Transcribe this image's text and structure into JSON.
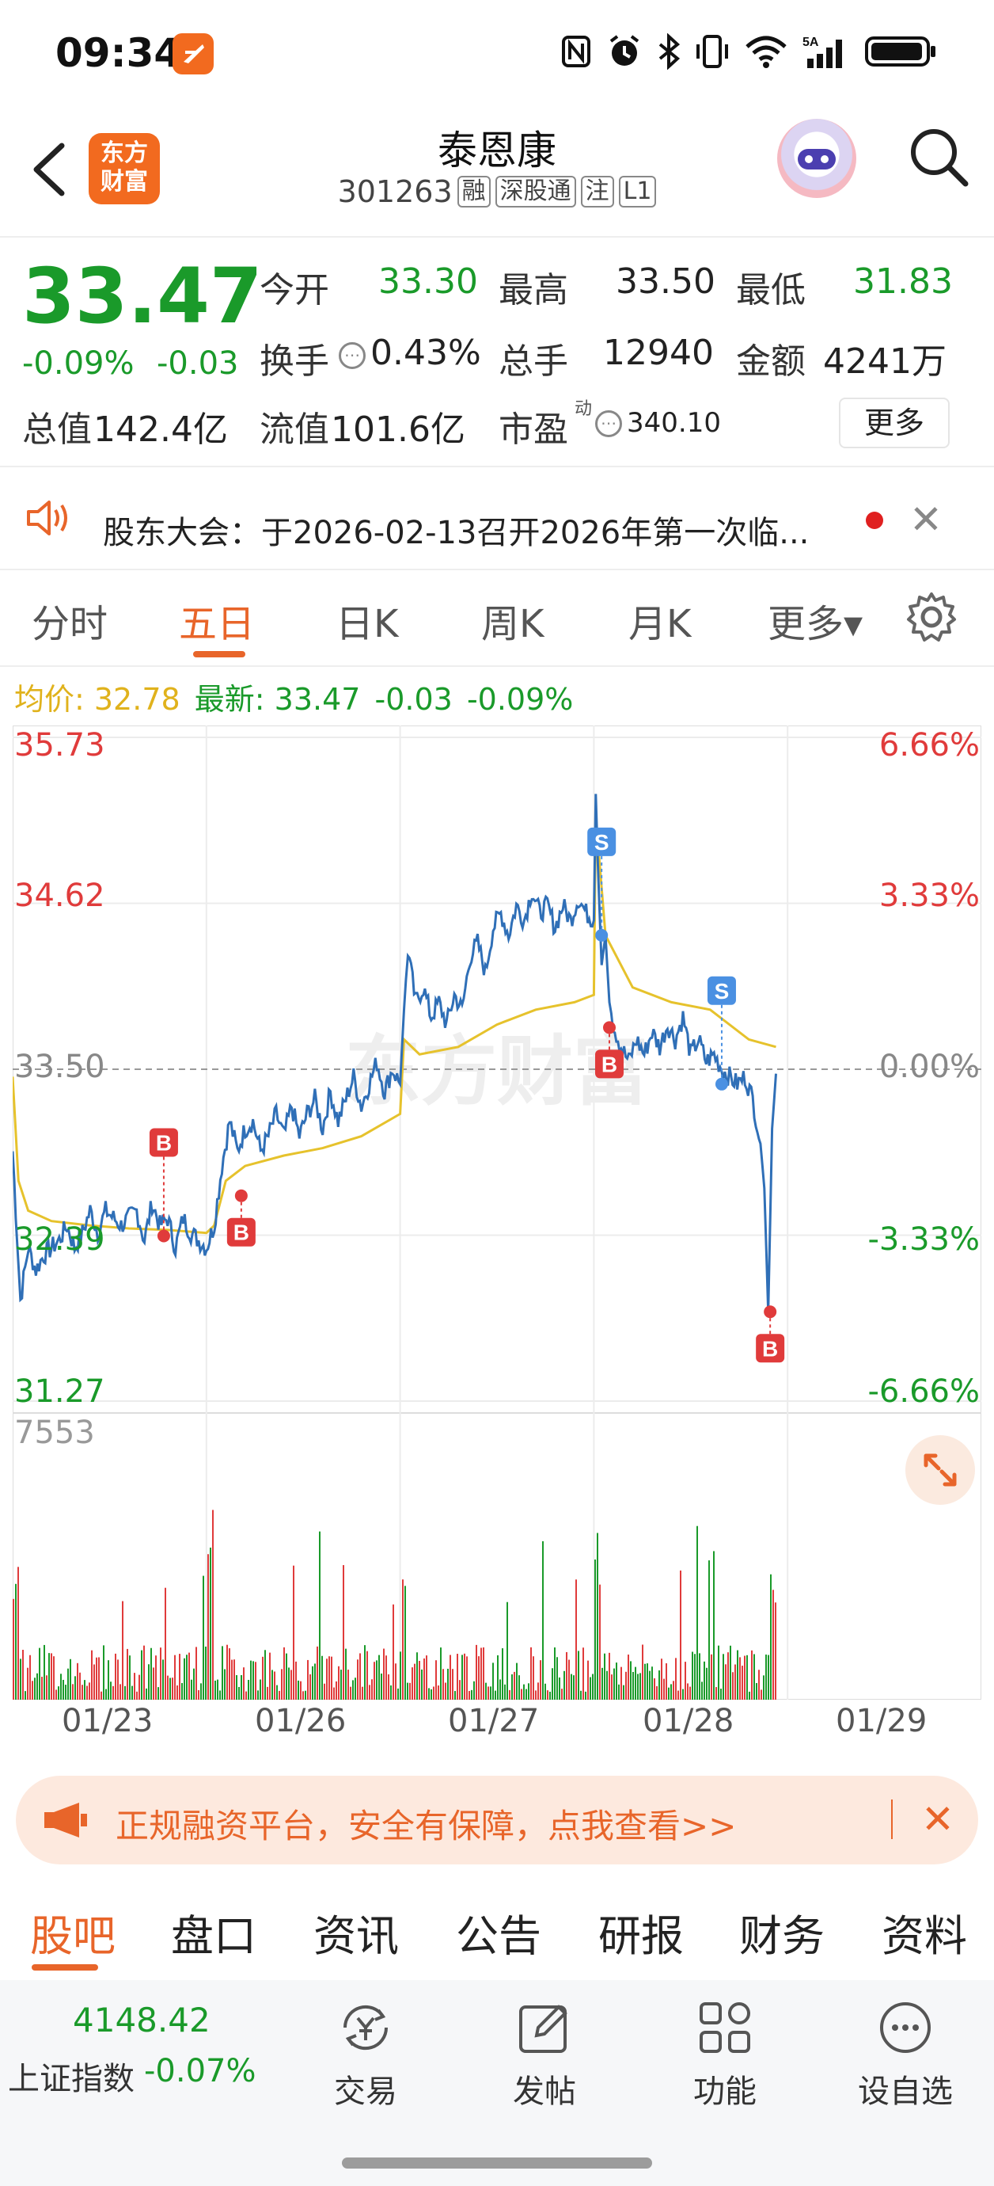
{
  "status_bar": {
    "time": "09:34",
    "icons": [
      "nfc-icon",
      "alarm-icon",
      "bluetooth-icon",
      "vibrate-icon",
      "wifi-icon",
      "signal-5a-icon",
      "battery-icon"
    ]
  },
  "header": {
    "logo_line1": "东方",
    "logo_line2": "财富",
    "stock_name": "泰恩康",
    "stock_code": "301263",
    "tags": [
      "融",
      "深股通",
      "注",
      "L1"
    ]
  },
  "quote": {
    "price": "33.47",
    "change_pct": "-0.09%",
    "change_abs": "-0.03",
    "open_label": "今开",
    "open": "33.30",
    "high_label": "最高",
    "high": "33.50",
    "low_label": "最低",
    "low": "31.83",
    "turnover_label": "换手",
    "turnover": "0.43%",
    "volume_label": "总手",
    "volume": "12940",
    "amount_label": "金额",
    "amount": "4241万",
    "mcap_label": "总值",
    "mcap": "142.4亿",
    "float_label": "流值",
    "float_mcap": "101.6亿",
    "pe_label": "市盈",
    "pe_sup": "动",
    "pe": "340.10",
    "more_label": "更多"
  },
  "notice": {
    "text": "股东大会：于2026-02-13召开2026年第一次临..."
  },
  "chart_tabs": [
    "分时",
    "五日",
    "日K",
    "周K",
    "月K",
    "更多▾"
  ],
  "active_chart_tab": "五日",
  "avg_line": {
    "avg": "均价: 32.78",
    "latest": "最新: 33.47",
    "chg": "-0.03",
    "pct": "-0.09%"
  },
  "watermark": "东方财富",
  "colors": {
    "accent": "#e8652a",
    "up": "#e03b3b",
    "down": "#1a9a2a",
    "price_line": "#2f6fb7",
    "avg_line": "#e6c22c"
  },
  "chart_data": {
    "type": "line",
    "title": "",
    "categories": [
      "01/23",
      "01/26",
      "01/27",
      "01/28",
      "01/29"
    ],
    "ylim": [
      31.27,
      35.73
    ],
    "y_ticks_left": [
      "35.73",
      "34.62",
      "33.50",
      "32.39",
      "31.27"
    ],
    "y_ticks_right": [
      "6.66%",
      "3.33%",
      "0.00%",
      "-3.33%",
      "-6.66%"
    ],
    "prev_close": 33.5,
    "volume_max_label": "7553",
    "series": [
      {
        "values": [
          [
            0.0,
            32.95
          ],
          [
            0.04,
            31.95
          ],
          [
            0.08,
            32.3
          ],
          [
            0.12,
            32.15
          ],
          [
            0.16,
            32.25
          ],
          [
            0.2,
            32.3
          ],
          [
            0.24,
            32.35
          ],
          [
            0.28,
            32.45
          ],
          [
            0.32,
            32.3
          ],
          [
            0.36,
            32.4
          ],
          [
            0.4,
            32.55
          ],
          [
            0.44,
            32.4
          ],
          [
            0.48,
            32.55
          ],
          [
            0.52,
            32.5
          ],
          [
            0.56,
            32.45
          ],
          [
            0.6,
            32.5
          ],
          [
            0.64,
            32.55
          ],
          [
            0.68,
            32.35
          ],
          [
            0.72,
            32.6
          ],
          [
            0.76,
            32.45
          ],
          [
            0.8,
            32.5
          ],
          [
            0.84,
            32.3
          ],
          [
            0.88,
            32.5
          ],
          [
            0.92,
            32.4
          ],
          [
            0.96,
            32.35
          ],
          [
            1.0,
            32.3
          ],
          [
            1.04,
            32.45
          ],
          [
            1.08,
            32.85
          ],
          [
            1.12,
            33.15
          ],
          [
            1.16,
            32.95
          ],
          [
            1.2,
            33.1
          ],
          [
            1.24,
            33.15
          ],
          [
            1.28,
            32.95
          ],
          [
            1.32,
            33.05
          ],
          [
            1.36,
            33.2
          ],
          [
            1.4,
            33.05
          ],
          [
            1.44,
            33.25
          ],
          [
            1.48,
            33.05
          ],
          [
            1.52,
            33.2
          ],
          [
            1.56,
            33.3
          ],
          [
            1.6,
            33.1
          ],
          [
            1.64,
            33.35
          ],
          [
            1.68,
            33.15
          ],
          [
            1.72,
            33.3
          ],
          [
            1.76,
            33.45
          ],
          [
            1.8,
            33.25
          ],
          [
            1.84,
            33.4
          ],
          [
            1.88,
            33.55
          ],
          [
            1.92,
            33.35
          ],
          [
            1.96,
            33.5
          ],
          [
            2.0,
            33.4
          ],
          [
            2.02,
            33.9
          ],
          [
            2.04,
            34.3
          ],
          [
            2.08,
            33.95
          ],
          [
            2.12,
            34.05
          ],
          [
            2.16,
            33.85
          ],
          [
            2.2,
            33.95
          ],
          [
            2.24,
            33.8
          ],
          [
            2.28,
            34.0
          ],
          [
            2.32,
            33.9
          ],
          [
            2.36,
            34.25
          ],
          [
            2.4,
            34.35
          ],
          [
            2.44,
            34.15
          ],
          [
            2.48,
            34.45
          ],
          [
            2.52,
            34.55
          ],
          [
            2.56,
            34.4
          ],
          [
            2.6,
            34.6
          ],
          [
            2.64,
            34.5
          ],
          [
            2.68,
            34.7
          ],
          [
            2.72,
            34.55
          ],
          [
            2.76,
            34.6
          ],
          [
            2.8,
            34.45
          ],
          [
            2.84,
            34.6
          ],
          [
            2.88,
            34.5
          ],
          [
            2.92,
            34.65
          ],
          [
            2.96,
            34.55
          ],
          [
            3.0,
            34.5
          ],
          [
            3.01,
            35.35
          ],
          [
            3.02,
            34.9
          ],
          [
            3.04,
            34.2
          ],
          [
            3.06,
            34.4
          ],
          [
            3.08,
            33.95
          ],
          [
            3.1,
            33.8
          ],
          [
            3.14,
            33.65
          ],
          [
            3.18,
            33.55
          ],
          [
            3.22,
            33.7
          ],
          [
            3.26,
            33.6
          ],
          [
            3.3,
            33.75
          ],
          [
            3.34,
            33.65
          ],
          [
            3.38,
            33.8
          ],
          [
            3.42,
            33.7
          ],
          [
            3.46,
            33.85
          ],
          [
            3.5,
            33.6
          ],
          [
            3.54,
            33.7
          ],
          [
            3.58,
            33.55
          ],
          [
            3.62,
            33.6
          ],
          [
            3.66,
            33.5
          ],
          [
            3.7,
            33.45
          ],
          [
            3.74,
            33.4
          ],
          [
            3.78,
            33.45
          ],
          [
            3.82,
            33.3
          ],
          [
            3.86,
            33.0
          ],
          [
            3.88,
            32.7
          ],
          [
            3.9,
            31.87
          ],
          [
            3.92,
            33.1
          ],
          [
            3.94,
            33.47
          ]
        ]
      },
      {
        "values": [
          [
            0.0,
            33.45
          ],
          [
            0.03,
            32.75
          ],
          [
            0.08,
            32.55
          ],
          [
            0.2,
            32.48
          ],
          [
            0.4,
            32.45
          ],
          [
            0.6,
            32.43
          ],
          [
            0.8,
            32.42
          ],
          [
            1.0,
            32.4
          ],
          [
            1.04,
            32.45
          ],
          [
            1.1,
            32.75
          ],
          [
            1.2,
            32.85
          ],
          [
            1.4,
            32.92
          ],
          [
            1.6,
            32.97
          ],
          [
            1.8,
            33.05
          ],
          [
            2.0,
            33.2
          ],
          [
            2.02,
            33.7
          ],
          [
            2.1,
            33.6
          ],
          [
            2.3,
            33.65
          ],
          [
            2.5,
            33.8
          ],
          [
            2.7,
            33.9
          ],
          [
            2.9,
            33.95
          ],
          [
            3.0,
            34.0
          ],
          [
            3.01,
            35.2
          ],
          [
            3.06,
            34.4
          ],
          [
            3.2,
            34.05
          ],
          [
            3.4,
            33.95
          ],
          [
            3.6,
            33.9
          ],
          [
            3.8,
            33.7
          ],
          [
            3.94,
            33.65
          ]
        ]
      }
    ],
    "markers": [
      {
        "label": "B",
        "x": 0.78,
        "y": 32.38,
        "color": "#e03b3b"
      },
      {
        "label": "B",
        "x": 1.18,
        "y": 32.65,
        "color": "#e03b3b"
      },
      {
        "label": "S",
        "x": 3.04,
        "y": 34.4,
        "color": "#4a90e2"
      },
      {
        "label": "B",
        "x": 3.08,
        "y": 33.78,
        "color": "#e03b3b"
      },
      {
        "label": "S",
        "x": 3.66,
        "y": 33.4,
        "color": "#4a90e2"
      },
      {
        "label": "B",
        "x": 3.91,
        "y": 31.87,
        "color": "#e03b3b"
      }
    ]
  },
  "promo": {
    "text": "正规融资平台，安全有保障，点我查看>>"
  },
  "section_tabs": [
    "股吧",
    "盘口",
    "资讯",
    "公告",
    "研报",
    "财务",
    "资料"
  ],
  "active_section_tab": "股吧",
  "bottom_nav": {
    "index_value": "4148.42",
    "index_name": "上证指数",
    "index_change": "-0.07%",
    "items": [
      {
        "label": "交易",
        "icon": "yuan-exchange-icon"
      },
      {
        "label": "发帖",
        "icon": "edit-post-icon"
      },
      {
        "label": "功能",
        "icon": "grid-function-icon"
      },
      {
        "label": "设自选",
        "icon": "more-dots-icon"
      }
    ]
  }
}
